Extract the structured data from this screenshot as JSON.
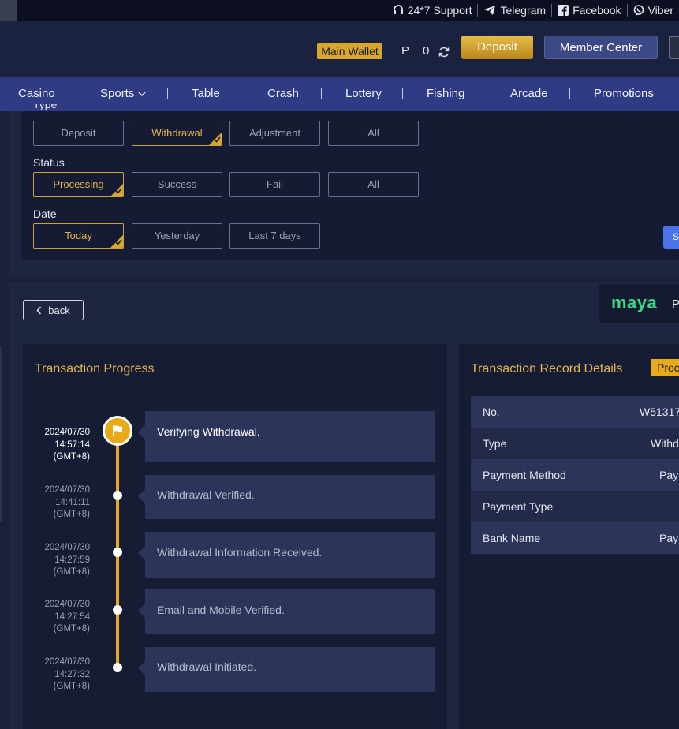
{
  "topbar": {
    "support": "24*7 Support",
    "telegram": "Telegram",
    "facebook": "Facebook",
    "viber": "Viber"
  },
  "header": {
    "wallet_label": "Main Wallet",
    "currency": "P",
    "balance": "0",
    "deposit": "Deposit",
    "member_center": "Member Center"
  },
  "nav": [
    "Casino",
    "Sports",
    "Table",
    "Crash",
    "Lottery",
    "Fishing",
    "Arcade",
    "Promotions"
  ],
  "filters": {
    "type_label": "Type",
    "type_options": [
      "Deposit",
      "Withdrawal",
      "Adjustment",
      "All"
    ],
    "type_selected": "Withdrawal",
    "status_label": "Status",
    "status_options": [
      "Processing",
      "Success",
      "Fail",
      "All"
    ],
    "status_selected": "Processing",
    "date_label": "Date",
    "date_options": [
      "Today",
      "Yesterday",
      "Last 7 days"
    ],
    "date_selected": "Today",
    "search_partial": "S"
  },
  "detail": {
    "back": "back",
    "provider_logo": "maya",
    "provider_partial": "P"
  },
  "progress": {
    "title": "Transaction Progress",
    "steps": [
      {
        "date": "2024/07/30",
        "time": "14:57:14",
        "tz": "(GMT+8)",
        "text": "Verifying Withdrawal."
      },
      {
        "date": "2024/07/30",
        "time": "14:41:11",
        "tz": "(GMT+8)",
        "text": "Withdrawal Verified."
      },
      {
        "date": "2024/07/30",
        "time": "14:27:59",
        "tz": "(GMT+8)",
        "text": "Withdrawal Information Received."
      },
      {
        "date": "2024/07/30",
        "time": "14:27:54",
        "tz": "(GMT+8)",
        "text": "Email and Mobile Verified."
      },
      {
        "date": "2024/07/30",
        "time": "14:27:32",
        "tz": "(GMT+8)",
        "text": "Withdrawal Initiated."
      }
    ]
  },
  "record": {
    "title": "Transaction Record Details",
    "status": "Processing",
    "rows": [
      {
        "label": "No.",
        "value": "W51317"
      },
      {
        "label": "Type",
        "value": "Withdrawal"
      },
      {
        "label": "Payment Method",
        "value": "Pay"
      },
      {
        "label": "Payment Type",
        "value": ""
      },
      {
        "label": "Bank Name",
        "value": "Pay"
      }
    ]
  },
  "colors": {
    "accent_gold": "#e8ab17",
    "nav_blue": "#2f3c85",
    "maya_green": "#3ed58c"
  }
}
